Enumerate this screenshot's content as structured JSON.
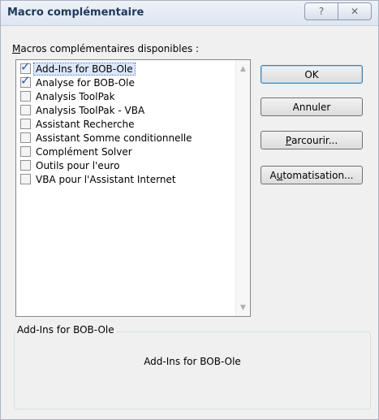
{
  "window": {
    "title": "Macro complémentaire",
    "help_icon": "?",
    "close_icon": "✕"
  },
  "list": {
    "label_prefix": "M",
    "label_rest": "acros complémentaires disponibles :",
    "items": [
      {
        "label": "Add-Ins for BOB-Ole",
        "checked": true,
        "selected": true
      },
      {
        "label": "Analyse for BOB-Ole",
        "checked": true,
        "selected": false
      },
      {
        "label": "Analysis ToolPak",
        "checked": false,
        "selected": false
      },
      {
        "label": "Analysis ToolPak - VBA",
        "checked": false,
        "selected": false
      },
      {
        "label": "Assistant Recherche",
        "checked": false,
        "selected": false
      },
      {
        "label": "Assistant Somme conditionnelle",
        "checked": false,
        "selected": false
      },
      {
        "label": "Complément Solver",
        "checked": false,
        "selected": false
      },
      {
        "label": "Outils pour l'euro",
        "checked": false,
        "selected": false
      },
      {
        "label": "VBA pour l'Assistant Internet",
        "checked": false,
        "selected": false
      }
    ]
  },
  "buttons": {
    "ok": "OK",
    "cancel": "Annuler",
    "browse_prefix": "P",
    "browse_rest": "arcourir...",
    "automation_prefix": "A",
    "automation_u": "u",
    "automation_rest": "tomatisation..."
  },
  "description": {
    "legend": "Add-Ins for BOB-Ole",
    "text": "Add-Ins for BOB-Ole"
  }
}
